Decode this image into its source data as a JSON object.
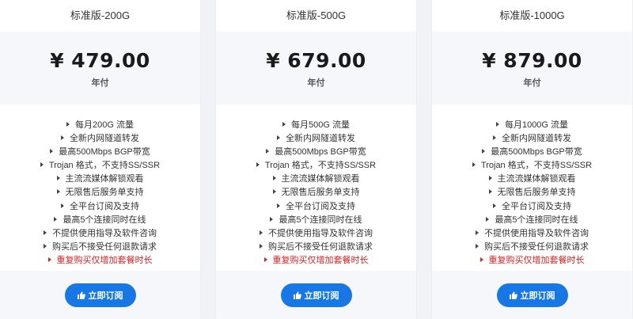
{
  "plans": [
    {
      "title": "标准版-200G",
      "price": "¥ 479.00",
      "period": "年付",
      "features": [
        "每月200G 流量",
        "全新内网隧道转发",
        "最高500Mbps BGP带宽",
        "Trojan 格式，不支持SS/SSR",
        "主流流媒体解锁观看",
        "无限售后服务单支持",
        "全平台订阅及支持",
        "最高5个连接同时在线",
        "不提供使用指导及软件咨询",
        "购买后不接受任何退款请求",
        "重复购买仅增加套餐时长"
      ],
      "button_label": "立即订阅"
    },
    {
      "title": "标准版-500G",
      "price": "¥ 679.00",
      "period": "年付",
      "features": [
        "每月500G 流量",
        "全新内网隧道转发",
        "最高500Mbps BGP带宽",
        "Trojan 格式，不支持SS/SSR",
        "主流流媒体解锁观看",
        "无限售后服务单支持",
        "全平台订阅及支持",
        "最高5个连接同时在线",
        "不提供使用指导及软件咨询",
        "购买后不接受任何退款请求",
        "重复购买仅增加套餐时长"
      ],
      "button_label": "立即订阅"
    },
    {
      "title": "标准版-1000G",
      "price": "¥ 879.00",
      "period": "年付",
      "features": [
        "每月1000G 流量",
        "全新内网隧道转发",
        "最高500Mbps BGP带宽",
        "Trojan 格式，不支持SS/SSR",
        "主流流媒体解锁观看",
        "无限售后服务单支持",
        "全平台订阅及支持",
        "最高5个连接同时在线",
        "不提供使用指导及软件咨询",
        "购买后不接受任何退款请求",
        "重复购买仅增加套餐时长"
      ],
      "button_label": "立即订阅"
    }
  ],
  "button_icon": "thumbs-up-icon",
  "colors": {
    "accent": "#1677e5",
    "highlight": "#e02020",
    "band": "#f5f7fa",
    "page_bg": "#f0f2f5"
  }
}
